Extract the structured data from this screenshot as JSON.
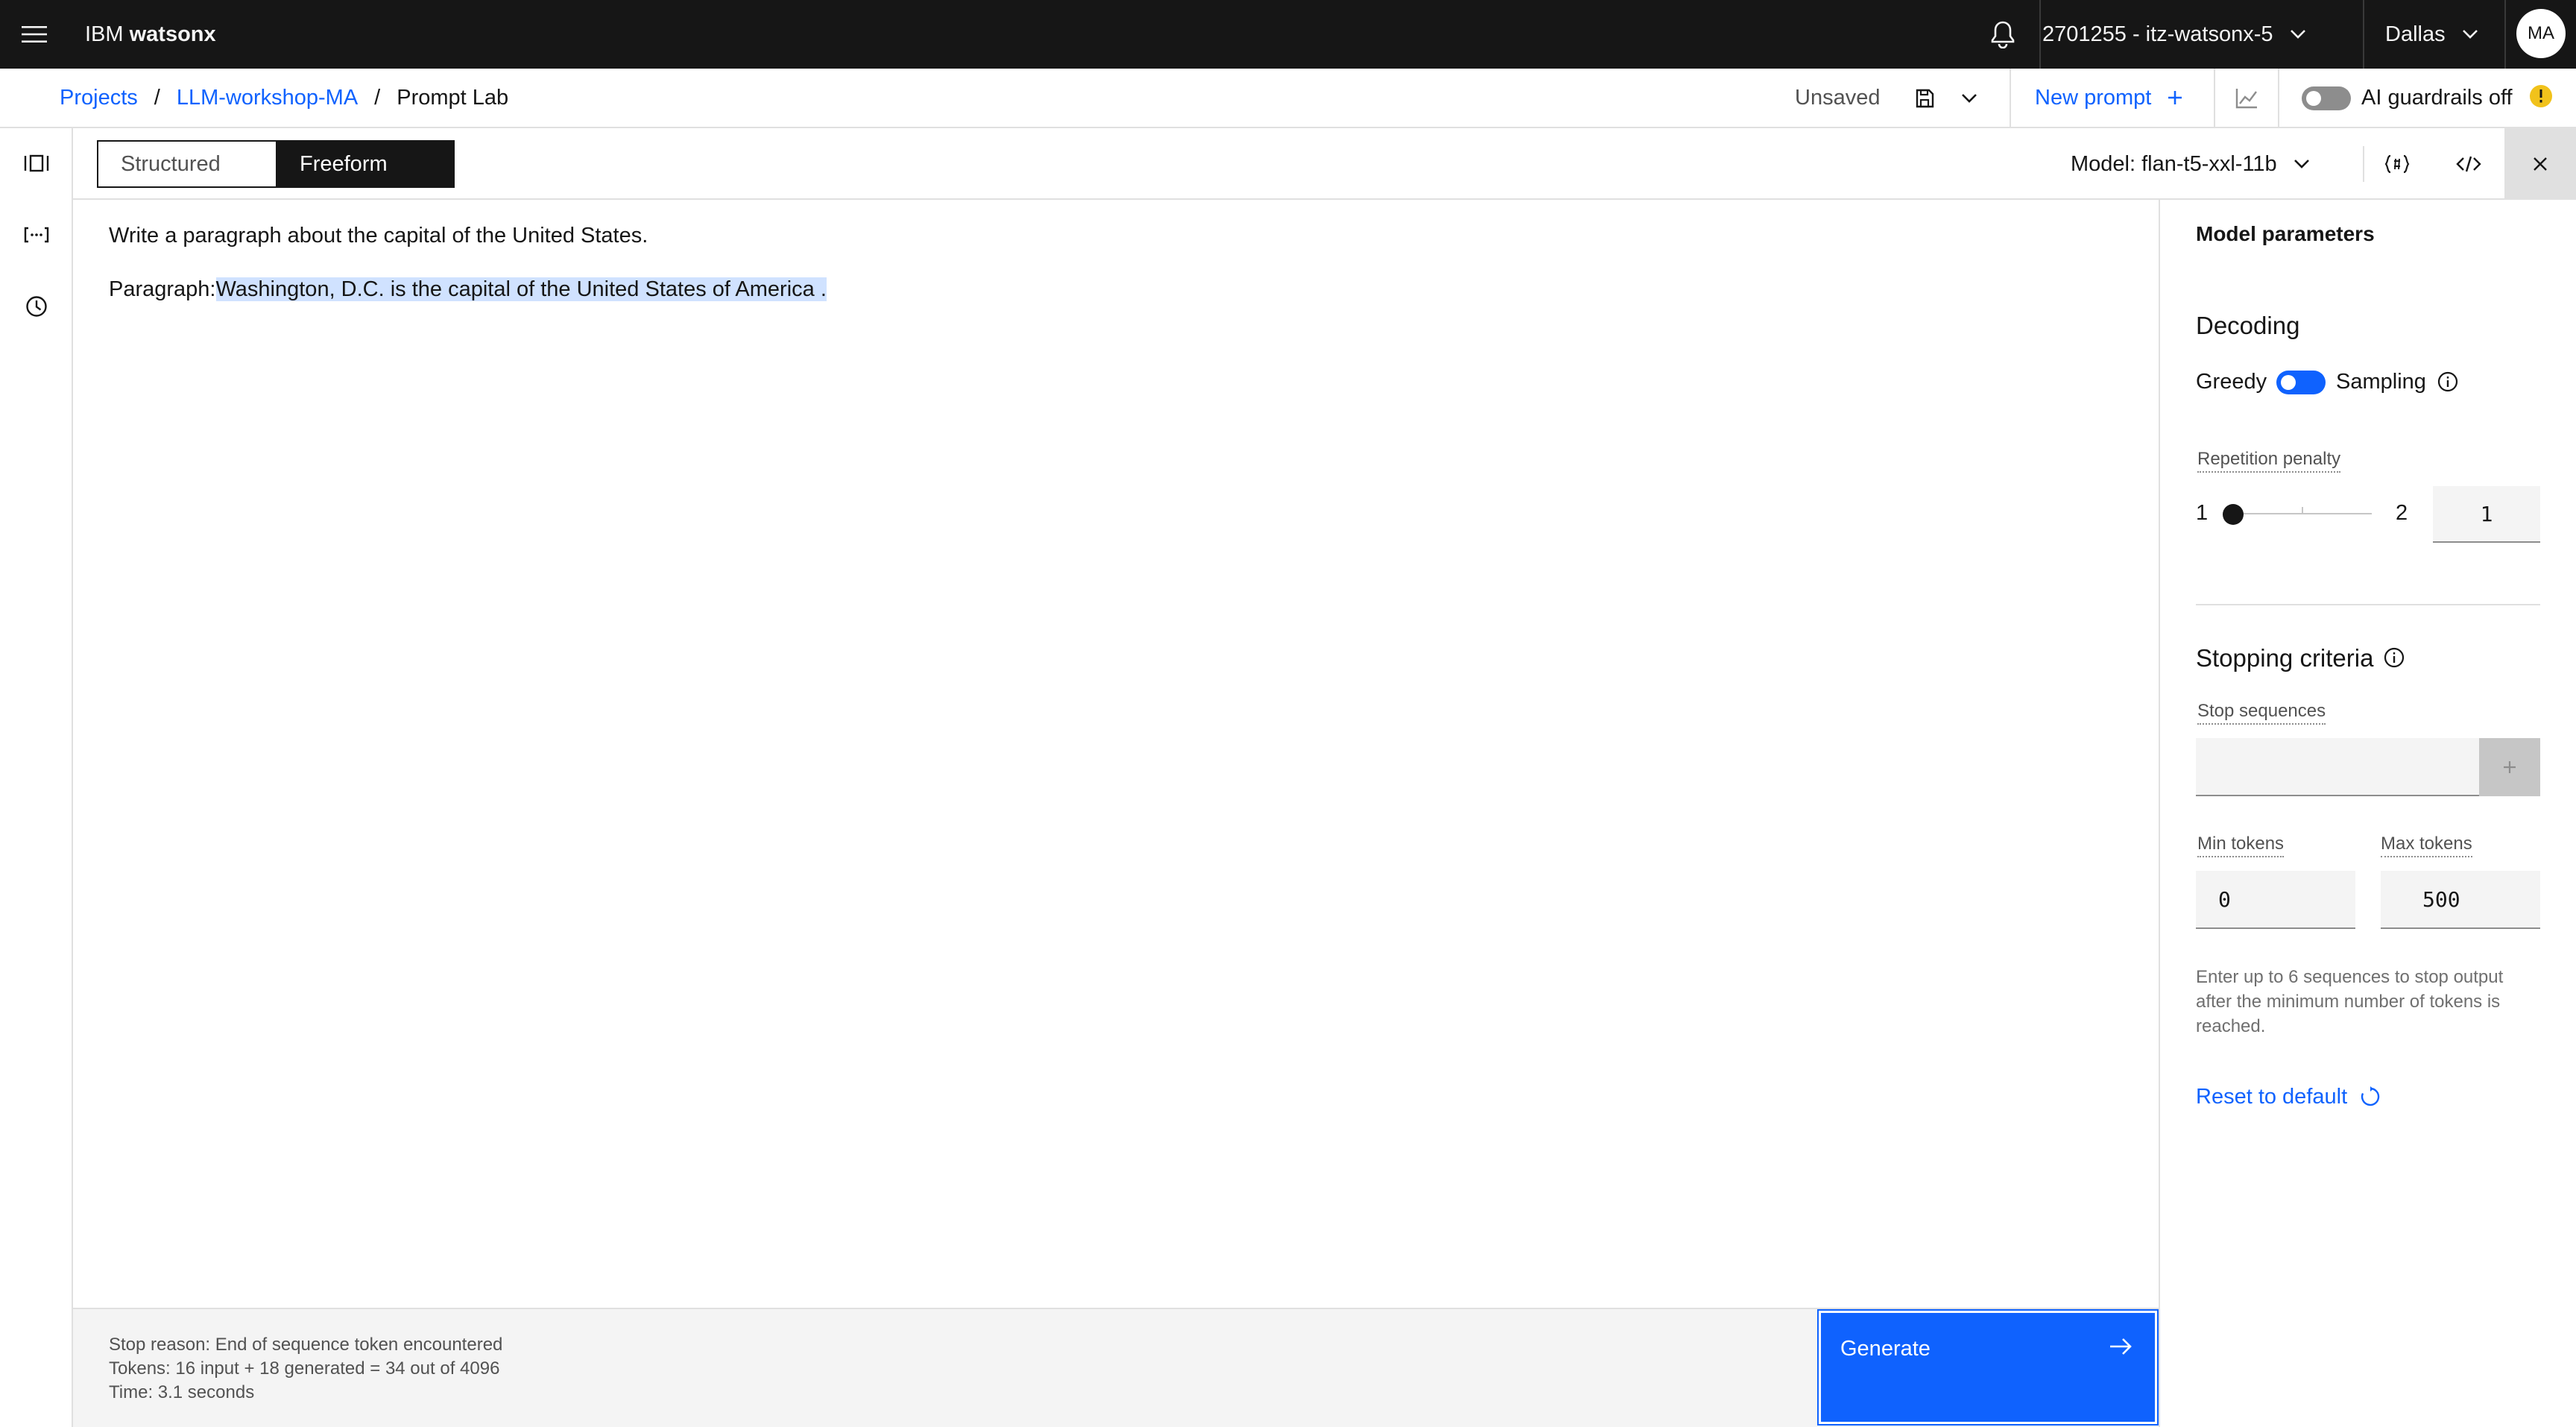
{
  "header": {
    "brand_prefix": "IBM",
    "brand_name": "watsonx",
    "account": "2701255 - itz-watsonx-5",
    "region": "Dallas",
    "avatar_initials": "MA"
  },
  "breadcrumb": {
    "items": [
      "Projects",
      "LLM-workshop-MA"
    ],
    "separator": "/",
    "current": "Prompt Lab"
  },
  "actions": {
    "save_status": "Unsaved",
    "new_prompt": "New prompt",
    "guardrails_label": "AI guardrails off"
  },
  "mode_tabs": {
    "structured": "Structured",
    "freeform": "Freeform",
    "selected": "Freeform"
  },
  "model_selector": "Model: flan-t5-xxl-11b",
  "editor": {
    "instruction": "Write a paragraph about the capital of the United States.",
    "prefix": "Paragraph:",
    "generated": "Washington, D.C. is the capital of the United States of America ."
  },
  "parameters": {
    "title": "Model parameters",
    "decoding": {
      "heading": "Decoding",
      "left": "Greedy",
      "right": "Sampling"
    },
    "repetition_penalty": {
      "label": "Repetition penalty",
      "min": "1",
      "max": "2",
      "value": "1"
    },
    "stopping": {
      "heading": "Stopping criteria",
      "stop_sequences_label": "Stop sequences",
      "min_tokens_label": "Min tokens",
      "min_tokens": "0",
      "max_tokens_label": "Max tokens",
      "max_tokens": "500",
      "help": "Enter up to 6 sequences to stop output after the minimum number of tokens is reached."
    },
    "reset": "Reset to default"
  },
  "status": {
    "stop_reason": "Stop reason: End of sequence token encountered",
    "tokens": "Tokens: 16 input + 18 generated = 34 out of 4096",
    "time": "Time: 3.1 seconds"
  },
  "generate_label": "Generate",
  "colors": {
    "accent": "#0f62fe",
    "header_bg": "#161616",
    "highlight": "#d0e2ff",
    "warning": "#f1c21b"
  }
}
